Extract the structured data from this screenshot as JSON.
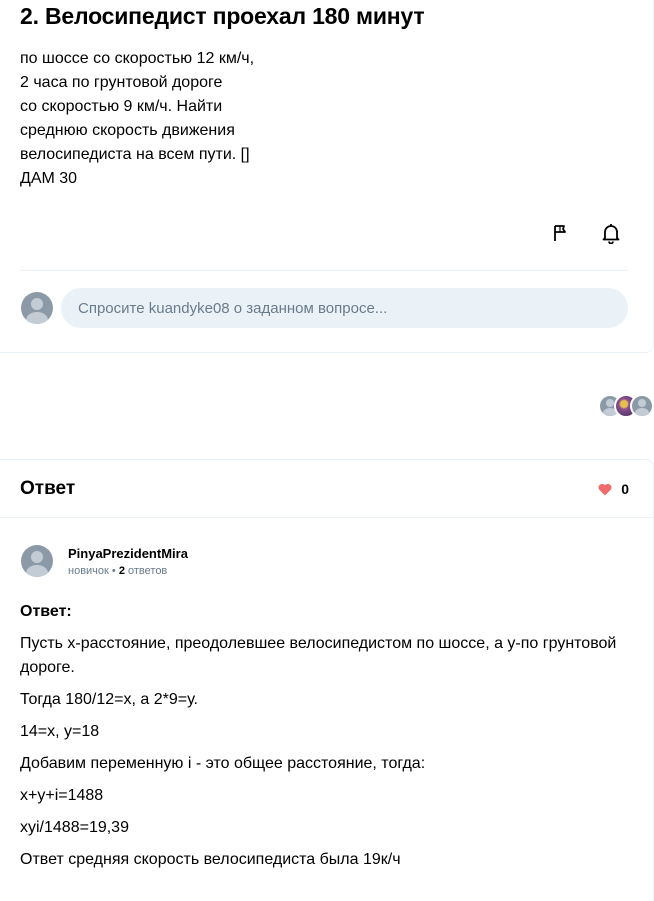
{
  "question": {
    "title": "2. Велосипедист проехал 180 минут",
    "body_lines": [
      "по шоссе со скоростью 12 км/ч,",
      "2 часа по грунтовой дороге",
      "со скоростью 9 км/ч. Найти",
      "среднюю скорость движения",
      "велосипедиста на всем пути. []",
      "ДАМ 30"
    ],
    "actions": {
      "report_icon": "flag-icon",
      "follow_icon": "bell-icon"
    },
    "ask_placeholder": "Спросите kuandyke08 о заданном вопросе..."
  },
  "answer": {
    "heading": "Ответ",
    "likes": "0",
    "author": {
      "name": "PinyaPrezidentMira",
      "rank": "новичок",
      "separator": "•",
      "answers_count": "2",
      "answers_label": "ответов"
    },
    "label": "Ответ:",
    "paragraphs": [
      "Пусть х-расстояние, преодолевшее велосипедистом по шоссе, а у-по грунтовой дороге.",
      "Тогда 180/12=х, а 2*9=у.",
      "14=х, у=18",
      "Добавим переменную i - это общее расстояние, тогда:",
      "х+у+i=1488",
      "хуi/1488=19,39",
      "Ответ средняя скорость велосипедиста была 19к/ч"
    ]
  },
  "colors": {
    "accent_heart": "#f06b6b",
    "panel": "#ebf2f7",
    "muted_text": "#687b8c"
  }
}
